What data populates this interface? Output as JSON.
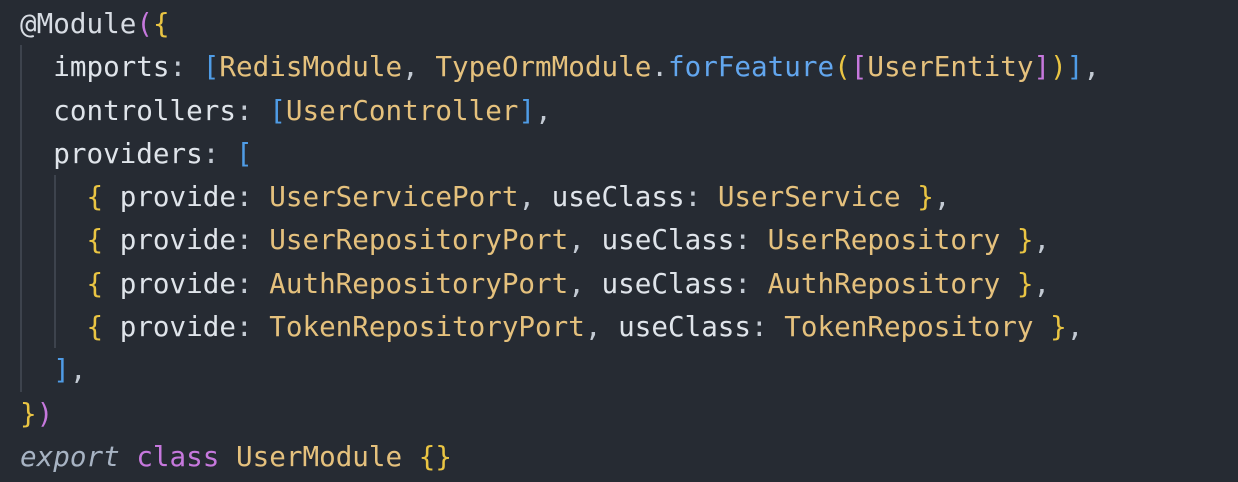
{
  "editor": {
    "language": "typescript",
    "colors": {
      "background": "#262b33",
      "decorator": "#d7dce3",
      "function": "#62a6ee",
      "bracket_level1": "#eac543",
      "bracket_level2": "#c678dd",
      "bracket_level3": "#4f9ce6",
      "property": "#dfe4ea",
      "class_name": "#e5c17d",
      "keyword": "#c678dd",
      "export_keyword": "#a7b3c3"
    },
    "lines": [
      {
        "tokens": [
          [
            "deco",
            "@"
          ],
          [
            "deco",
            "Module"
          ],
          [
            "p2",
            "("
          ],
          [
            "p1",
            "{"
          ]
        ]
      },
      {
        "tokens": [
          [
            "plain",
            "  "
          ],
          [
            "prop",
            "imports"
          ],
          [
            "punc",
            ": "
          ],
          [
            "p3",
            "["
          ],
          [
            "cls",
            "RedisModule"
          ],
          [
            "punc",
            ", "
          ],
          [
            "cls",
            "TypeOrmModule"
          ],
          [
            "punc",
            "."
          ],
          [
            "fn",
            "forFeature"
          ],
          [
            "p1",
            "("
          ],
          [
            "p2",
            "["
          ],
          [
            "cls",
            "UserEntity"
          ],
          [
            "p2",
            "]"
          ],
          [
            "p1",
            ")"
          ],
          [
            "p3",
            "]"
          ],
          [
            "punc",
            ","
          ]
        ]
      },
      {
        "tokens": [
          [
            "plain",
            "  "
          ],
          [
            "prop",
            "controllers"
          ],
          [
            "punc",
            ": "
          ],
          [
            "p3",
            "["
          ],
          [
            "cls",
            "UserController"
          ],
          [
            "p3",
            "]"
          ],
          [
            "punc",
            ","
          ]
        ]
      },
      {
        "tokens": [
          [
            "plain",
            "  "
          ],
          [
            "prop",
            "providers"
          ],
          [
            "punc",
            ": "
          ],
          [
            "p3",
            "["
          ]
        ]
      },
      {
        "tokens": [
          [
            "plain",
            "    "
          ],
          [
            "p1",
            "{"
          ],
          [
            "plain",
            " "
          ],
          [
            "prop",
            "provide"
          ],
          [
            "punc",
            ": "
          ],
          [
            "cls",
            "UserServicePort"
          ],
          [
            "punc",
            ", "
          ],
          [
            "prop",
            "useClass"
          ],
          [
            "punc",
            ": "
          ],
          [
            "cls",
            "UserService"
          ],
          [
            "plain",
            " "
          ],
          [
            "p1",
            "}"
          ],
          [
            "punc",
            ","
          ]
        ]
      },
      {
        "tokens": [
          [
            "plain",
            "    "
          ],
          [
            "p1",
            "{"
          ],
          [
            "plain",
            " "
          ],
          [
            "prop",
            "provide"
          ],
          [
            "punc",
            ": "
          ],
          [
            "cls",
            "UserRepositoryPort"
          ],
          [
            "punc",
            ", "
          ],
          [
            "prop",
            "useClass"
          ],
          [
            "punc",
            ": "
          ],
          [
            "cls",
            "UserRepository"
          ],
          [
            "plain",
            " "
          ],
          [
            "p1",
            "}"
          ],
          [
            "punc",
            ","
          ]
        ]
      },
      {
        "tokens": [
          [
            "plain",
            "    "
          ],
          [
            "p1",
            "{"
          ],
          [
            "plain",
            " "
          ],
          [
            "prop",
            "provide"
          ],
          [
            "punc",
            ": "
          ],
          [
            "cls",
            "AuthRepositoryPort"
          ],
          [
            "punc",
            ", "
          ],
          [
            "prop",
            "useClass"
          ],
          [
            "punc",
            ": "
          ],
          [
            "cls",
            "AuthRepository"
          ],
          [
            "plain",
            " "
          ],
          [
            "p1",
            "}"
          ],
          [
            "punc",
            ","
          ]
        ]
      },
      {
        "tokens": [
          [
            "plain",
            "    "
          ],
          [
            "p1",
            "{"
          ],
          [
            "plain",
            " "
          ],
          [
            "prop",
            "provide"
          ],
          [
            "punc",
            ": "
          ],
          [
            "cls",
            "TokenRepositoryPort"
          ],
          [
            "punc",
            ", "
          ],
          [
            "prop",
            "useClass"
          ],
          [
            "punc",
            ": "
          ],
          [
            "cls",
            "TokenRepository"
          ],
          [
            "plain",
            " "
          ],
          [
            "p1",
            "}"
          ],
          [
            "punc",
            ","
          ]
        ]
      },
      {
        "tokens": [
          [
            "plain",
            "  "
          ],
          [
            "p3",
            "]"
          ],
          [
            "punc",
            ","
          ]
        ]
      },
      {
        "tokens": [
          [
            "p1",
            "}"
          ],
          [
            "p2",
            ")"
          ]
        ]
      },
      {
        "tokens": [
          [
            "kw-it",
            "export"
          ],
          [
            "plain",
            " "
          ],
          [
            "kw",
            "class"
          ],
          [
            "plain",
            " "
          ],
          [
            "cls",
            "UserModule"
          ],
          [
            "plain",
            " "
          ],
          [
            "p1",
            "{}"
          ]
        ]
      }
    ]
  }
}
